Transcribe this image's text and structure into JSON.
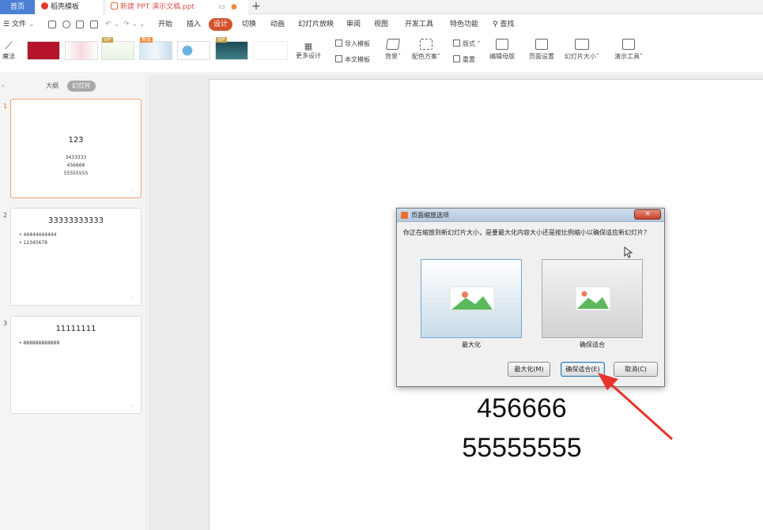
{
  "tabs": {
    "home": "首页",
    "templates": "稻壳模板",
    "document": "新建 PPT 演示文稿.ppt",
    "add": "+"
  },
  "menu": {
    "file": "文件",
    "items": [
      "开始",
      "插入",
      "设计",
      "切换",
      "动画",
      "幻灯片放映",
      "审阅",
      "视图",
      "开发工具",
      "特色功能"
    ],
    "active": "设计",
    "search": "查找"
  },
  "ribbon": {
    "magic": "魔法",
    "more_designs": "更多设计",
    "import_template": "导入模板",
    "body_template": "本文模板",
    "background": "背景",
    "color_scheme": "配色方案",
    "layout": "版式",
    "reset": "重置",
    "edit_master": "编辑母版",
    "page_setup": "页面设置",
    "slide_size": "幻灯片大小",
    "present_tools": "演示工具",
    "badge_vip": "VIP",
    "badge_new": "新品"
  },
  "panel": {
    "outline_tab": "大纲",
    "slides_tab": "幻灯片"
  },
  "slides": [
    {
      "num": "1",
      "title": "123",
      "lines": [
        "3433333",
        "456666",
        "55555555"
      ]
    },
    {
      "num": "2",
      "title": "33333333333",
      "bullets": [
        "44444444444",
        "12345678"
      ]
    },
    {
      "num": "3",
      "title": "11111111",
      "bullets": [
        "888888888888"
      ]
    }
  ],
  "canvas": {
    "line1": "456666",
    "line2": "55555555"
  },
  "dialog": {
    "title": "页面缩放选项",
    "close": "×",
    "message": "你正在缩放到新幻灯片大小，是要最大化内容大小还是按比例缩小以确保适应新幻灯片？",
    "option_max": "最大化",
    "option_fit": "确保适合",
    "btn_max": "最大化(M)",
    "btn_fit": "确保适合(E)",
    "btn_cancel": "取消(C)"
  },
  "colors": {
    "accent": "#d2542f",
    "home_tab": "#4a7fd4",
    "annotation_arrow": "#e8332a"
  }
}
